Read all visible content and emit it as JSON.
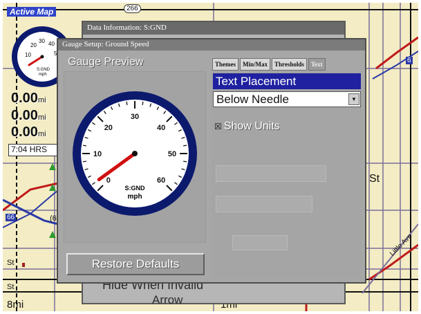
{
  "map": {
    "active_map_label": "Active Map",
    "road_shields": [
      "266",
      "(6",
      "6",
      "66"
    ],
    "street_labels": [
      "St",
      "St",
      "St",
      "Little Ave"
    ],
    "scale_left": "8mi",
    "scale_right": "1mi"
  },
  "mini_gauge": {
    "ticks": [
      "20",
      "30",
      "40",
      "10",
      "50"
    ],
    "unit": "S:GND",
    "unit2": "mph",
    "needle_value": 7
  },
  "readouts": [
    {
      "value": "0.00",
      "unit": "mi"
    },
    {
      "value": "0.00",
      "unit": "mi"
    },
    {
      "value": "0.00",
      "unit": "mi"
    }
  ],
  "time_readout": "7:04 HRS",
  "background_dialog": {
    "title": "Data Information: S:GND",
    "hidden_text": "Hide When Invalid",
    "hidden_text_2": "Arrow"
  },
  "dialog": {
    "title": "Gauge Setup: Ground Speed",
    "preview_label": "Gauge Preview",
    "restore_button": "Restore Defaults",
    "tabs": [
      {
        "label": "Themes",
        "active": false
      },
      {
        "label": "Min/Max",
        "active": false
      },
      {
        "label": "Thresholds",
        "active": false
      },
      {
        "label": "Text",
        "active": true
      }
    ],
    "text_placement_header": "Text Placement",
    "placement_select": {
      "value": "Below Needle"
    },
    "show_units": {
      "label": "Show Units",
      "checked": true,
      "mark": "☒"
    }
  },
  "gauge": {
    "ticks": [
      "0",
      "10",
      "20",
      "30",
      "40",
      "50",
      "60"
    ],
    "label_line1": "S:GND",
    "label_line2": "mph",
    "min": 0,
    "max": 60,
    "needle_value": 2,
    "ring_color": "#0c1a6e",
    "needle_color": "#d01010"
  },
  "colors": {
    "map_bg": "#f3ecc4",
    "road_red": "#c01a1a",
    "road_blue": "#2a3aa8",
    "selection_blue": "#1f21a0"
  }
}
